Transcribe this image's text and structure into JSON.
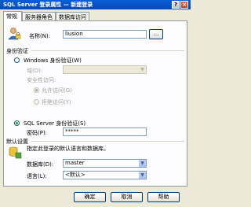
{
  "window": {
    "title": "SQL Server 登录属性 — 新建登录",
    "help_btn": "?",
    "close_btn": "×"
  },
  "tabs": [
    {
      "label": "常规"
    },
    {
      "label": "服务器角色"
    },
    {
      "label": "数据库访问"
    }
  ],
  "general": {
    "name_label": "名称(N):",
    "name_value": "liusion",
    "browse_label": "..."
  },
  "auth": {
    "section_label": "身份验证",
    "windows_label": "Windows 身份验证(W)",
    "domain_label": "域(D):",
    "security_access_label": "安全性访问:",
    "grant_label": "允许访问(G)",
    "deny_label": "拒绝访问(Y)",
    "sql_label": "SQL Server 身份验证(S)",
    "password_label": "密码(P):",
    "password_value": "*****"
  },
  "defaults": {
    "section_label": "默认设置",
    "description": "指定此登录的默认语言和数据库。",
    "database_label": "数据库(D):",
    "database_value": "master",
    "language_label": "语言(L):",
    "language_value": "<默认>"
  },
  "footer": {
    "ok": "确定",
    "cancel": "取消",
    "help": "帮助"
  }
}
